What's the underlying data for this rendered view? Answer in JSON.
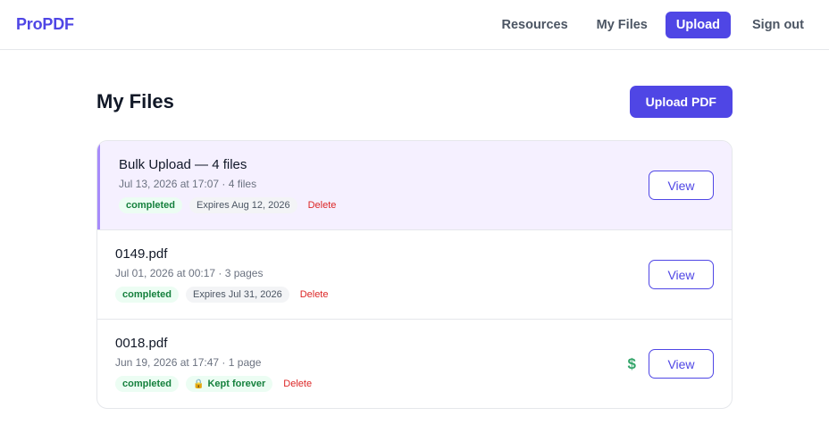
{
  "brand": "ProPDF",
  "nav": {
    "resources": "Resources",
    "my_files": "My Files",
    "upload": "Upload",
    "sign_out": "Sign out"
  },
  "page": {
    "title": "My Files",
    "upload_button": "Upload PDF"
  },
  "files": [
    {
      "name": "Bulk Upload — 4 files",
      "meta": "Jul 13, 2026 at 17:07 · 4 files",
      "status": "completed",
      "retention": "Expires Aug 12, 2026",
      "delete": "Delete",
      "view": "View"
    },
    {
      "name": "0149.pdf",
      "meta": "Jul 01, 2026 at 00:17 · 3 pages",
      "status": "completed",
      "retention": "Expires Jul 31, 2026",
      "delete": "Delete",
      "view": "View"
    },
    {
      "name": "0018.pdf",
      "meta": "Jun 19, 2026 at 17:47 · 1 page",
      "status": "completed",
      "retention": "Kept forever",
      "lock_icon": "🔒",
      "dollar_icon": "$",
      "delete": "Delete",
      "view": "View"
    }
  ],
  "colors": {
    "accent": "#4f46e5",
    "highlight_row": "#f5f0ff",
    "success": "#15803d",
    "danger": "#dc2626"
  }
}
